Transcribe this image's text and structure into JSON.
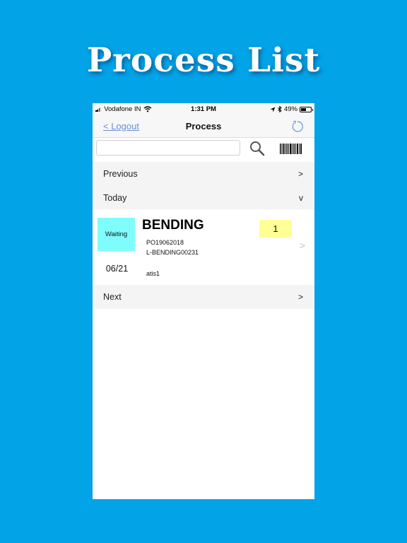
{
  "banner": {
    "title": "Process List"
  },
  "statusbar": {
    "carrier": "Vodafone IN",
    "time": "1:31 PM",
    "battery_percent": "49%",
    "battery_level": 0.49
  },
  "navbar": {
    "back_label": "< Logout",
    "title": "Process",
    "refresh_icon": "refresh-icon"
  },
  "search": {
    "value": "",
    "placeholder": "",
    "search_icon": "search-icon",
    "barcode_icon": "barcode-icon"
  },
  "sections": {
    "previous": {
      "label": "Previous",
      "chevron": ">"
    },
    "today": {
      "label": "Today",
      "chevron": "v"
    },
    "next": {
      "label": "Next",
      "chevron": ">"
    }
  },
  "items": [
    {
      "status": "Waiting",
      "status_color": "#7ffdfd",
      "date": "06/21",
      "title": "BENDING",
      "quantity": "1",
      "quantity_color": "#ffff96",
      "po": "PO19062018",
      "code": "L-BENDING00231",
      "user": "atis1",
      "arrow": ">"
    }
  ],
  "colors": {
    "background": "#03a3e8",
    "link": "#6a8fd0",
    "section_bg": "#f4f4f4"
  }
}
